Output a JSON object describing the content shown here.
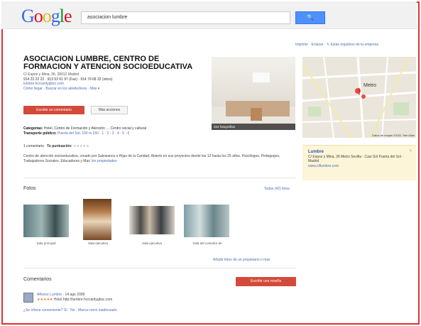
{
  "search": {
    "query": "asociacion lumbre",
    "button_icon": "search-icon",
    "button_label": "🔍"
  },
  "top_links": "Imprimir · Enlazar · ✎ Estás orgulloso de tu empresa",
  "place": {
    "title": "ASOCIACION LUMBRE, CENTRO DE FORMACION Y ATENCION SOCIOEDUCATIVA",
    "address": "C/ Espoz y Mina, 36, 28012 Madrid",
    "phones": "914 22 22 22 · 913 53 61 97 (Fax) · 914 79 68 32 (otros)",
    "website": "lumbre.hcrcaritygbsc.com",
    "links": "Cómo llegar · Buscar en los alrededores · Más ▾"
  },
  "actions": {
    "primary": "Escribir un comentario",
    "secondary": "Más acciones"
  },
  "main_photo_caption": "324 fotografías",
  "categories": {
    "label": "Categorías:",
    "value": "Hotel, Centro de Formación y Atención … Centro social y cultural",
    "transport_label": "Transporte público:",
    "transport_value": "Puerta del Sol, 150 m 150 · 1 · 2 · 3 · 4 · 5 · 6"
  },
  "reviews_line": {
    "count": "1 comentario",
    "score_label": "Tu puntuación:",
    "stars": "★★★★★"
  },
  "description": {
    "text": "Centro de atención socioeducativa, creado por Salesianos e Hijas de la Caridad. Abierto en sus proyectos desde los 12 hasta los 25 años. Psicólogos, Pedagogos, Trabajadores Sociales, Educadores y Mas",
    "more": "Ver propiedades"
  },
  "photos": {
    "label": "Fotos",
    "see_all": "Todas (42) fotos",
    "captions": [
      "Sala principal",
      "Sala ejecutiva",
      "Sala ejecutiva",
      "Sala del comedor de"
    ],
    "upload": "Añadir fotos de un propietario o mas"
  },
  "comments": {
    "label": "Comentarios",
    "write_button": "Escribir una reseña",
    "review": {
      "author": "Alfonso Lumbre",
      "date": "14 ago 2009",
      "stars": "★★★★★",
      "text": "Hola! http://lumbre.hcrcaritygbsc.com"
    },
    "footer": "¿Se ofrece conveniente? Sí · No · Marca como inadecuado"
  },
  "map": {
    "label": "Metro",
    "credit": "Datos de mapas ©2011 Tele Atlas"
  },
  "infobox": {
    "title": "Lumbre",
    "lines": "C/ Espoz y Mina, 36 Metro Sevilla · Casi Sol Puerta del Sol · Madrid",
    "link": "www.ciflumbre.com"
  },
  "colors": {
    "accent_red": "#d44a3a",
    "link_blue": "#4a6fb5",
    "search_blue": "#4d90fe"
  }
}
